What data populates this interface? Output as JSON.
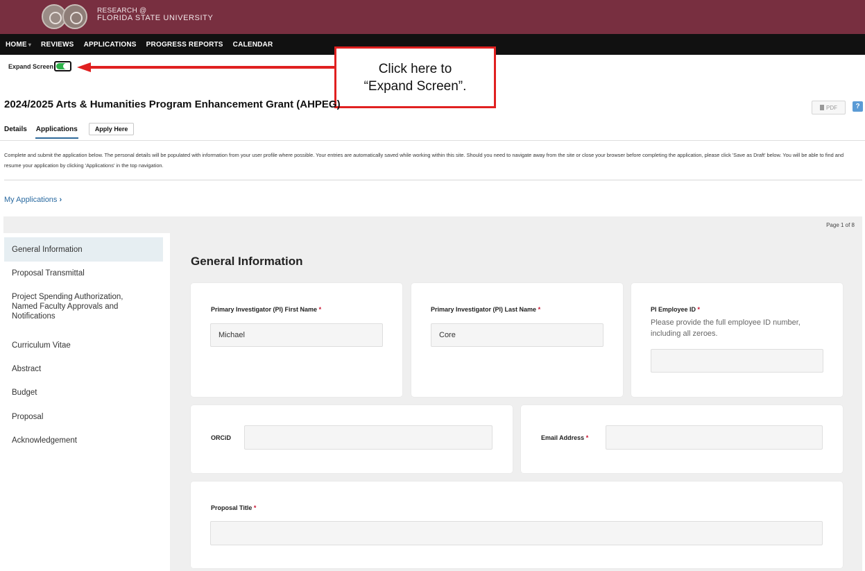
{
  "brand": {
    "line1": "RESEARCH @",
    "line2": "FLORIDA STATE UNIVERSITY"
  },
  "nav": {
    "items": [
      "HOME",
      "REVIEWS",
      "APPLICATIONS",
      "PROGRESS REPORTS",
      "CALENDAR"
    ],
    "home_caret": "▾"
  },
  "expand": {
    "label": "Expand Screen",
    "enabled": true
  },
  "callout": {
    "line1": "Click here to",
    "line2": "“Expand Screen”."
  },
  "page": {
    "title": "2024/2025 Arts & Humanities Program Enhancement Grant (AHPEG)",
    "pdf_label": "PDF",
    "help_label": "?"
  },
  "tabs": {
    "details": "Details",
    "applications": "Applications",
    "apply": "Apply Here"
  },
  "intro": "Complete and submit the application below. The personal details will be populated with information from your user profile where possible. Your entries are automatically saved while working within this site. Should you need to navigate away from the site or close your browser before completing the application, please click 'Save as Draft' below. You will be able to find and resume your application by clicking 'Applications' in the top navigation.",
  "breadcrumb": {
    "label": "My Applications",
    "chevron": "›"
  },
  "pager": "Page 1 of 8",
  "sidebar": {
    "items": [
      "General Information",
      "Proposal Transmittal",
      "Project Spending Authorization, Named Faculty Approvals and Notifications",
      "Curriculum Vitae",
      "Abstract",
      "Budget",
      "Proposal",
      "Acknowledgement"
    ]
  },
  "form": {
    "section_title": "General Information",
    "required_mark": "*",
    "pi_first_name": {
      "label": "Primary Investigator (PI) First Name",
      "value": "Michael"
    },
    "pi_last_name": {
      "label": "Primary Investigator (PI) Last Name",
      "value": "Core"
    },
    "pi_employee_id": {
      "label": "PI Employee ID",
      "help": "Please provide the full employee ID number, including all zeroes.",
      "value": ""
    },
    "orcid": {
      "label": "ORCiD",
      "value": ""
    },
    "email": {
      "label": "Email Address",
      "value": ""
    },
    "proposal_title": {
      "label": "Proposal Title",
      "value": ""
    }
  },
  "colors": {
    "brand_garnet": "#782f40",
    "nav_black": "#111111",
    "toggle_on": "#2db34a",
    "callout_red": "#e02020",
    "link_blue": "#2a6aa0",
    "required_red": "#c8102e"
  }
}
